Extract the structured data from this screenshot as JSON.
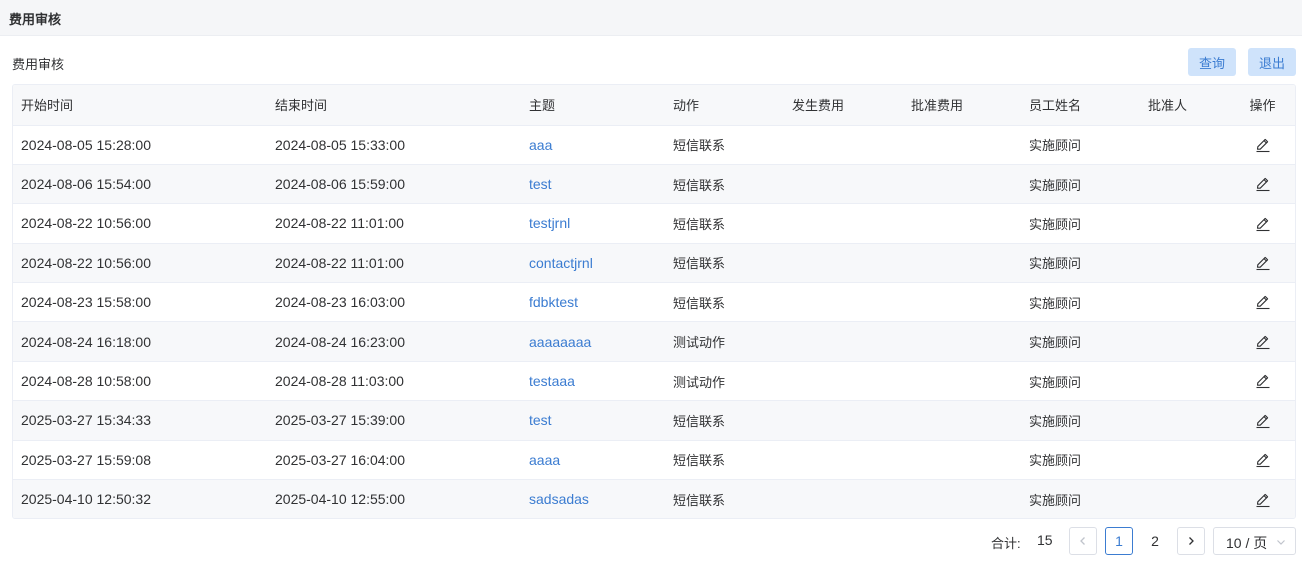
{
  "header": {
    "title": "费用审核"
  },
  "section": {
    "title": "费用审核"
  },
  "toolbar": {
    "query_label": "查询",
    "exit_label": "退出"
  },
  "table": {
    "columns": [
      "开始时间",
      "结束时间",
      "主题",
      "动作",
      "发生费用",
      "批准费用",
      "员工姓名",
      "批准人",
      "操作"
    ],
    "rows": [
      {
        "start": "2024-08-05 15:28:00",
        "end": "2024-08-05 15:33:00",
        "subject": "aaa",
        "action": "短信联系",
        "cost": "",
        "approved_cost": "",
        "employee": "实施顾问",
        "approver": ""
      },
      {
        "start": "2024-08-06 15:54:00",
        "end": "2024-08-06 15:59:00",
        "subject": "test",
        "action": "短信联系",
        "cost": "",
        "approved_cost": "",
        "employee": "实施顾问",
        "approver": ""
      },
      {
        "start": "2024-08-22 10:56:00",
        "end": "2024-08-22 11:01:00",
        "subject": "testjrnl",
        "action": "短信联系",
        "cost": "",
        "approved_cost": "",
        "employee": "实施顾问",
        "approver": ""
      },
      {
        "start": "2024-08-22 10:56:00",
        "end": "2024-08-22 11:01:00",
        "subject": "contactjrnl",
        "action": "短信联系",
        "cost": "",
        "approved_cost": "",
        "employee": "实施顾问",
        "approver": ""
      },
      {
        "start": "2024-08-23 15:58:00",
        "end": "2024-08-23 16:03:00",
        "subject": "fdbktest",
        "action": "短信联系",
        "cost": "",
        "approved_cost": "",
        "employee": "实施顾问",
        "approver": ""
      },
      {
        "start": "2024-08-24 16:18:00",
        "end": "2024-08-24 16:23:00",
        "subject": "aaaaaaaa",
        "action": "测试动作",
        "cost": "",
        "approved_cost": "",
        "employee": "实施顾问",
        "approver": ""
      },
      {
        "start": "2024-08-28 10:58:00",
        "end": "2024-08-28 11:03:00",
        "subject": "testaaa",
        "action": "测试动作",
        "cost": "",
        "approved_cost": "",
        "employee": "实施顾问",
        "approver": ""
      },
      {
        "start": "2025-03-27 15:34:33",
        "end": "2025-03-27 15:39:00",
        "subject": "test",
        "action": "短信联系",
        "cost": "",
        "approved_cost": "",
        "employee": "实施顾问",
        "approver": ""
      },
      {
        "start": "2025-03-27 15:59:08",
        "end": "2025-03-27 16:04:00",
        "subject": "aaaa",
        "action": "短信联系",
        "cost": "",
        "approved_cost": "",
        "employee": "实施顾问",
        "approver": ""
      },
      {
        "start": "2025-04-10 12:50:32",
        "end": "2025-04-10 12:55:00",
        "subject": "sadsadas",
        "action": "短信联系",
        "cost": "",
        "approved_cost": "",
        "employee": "实施顾问",
        "approver": ""
      }
    ],
    "row_action_icon": "edit-icon"
  },
  "pagination": {
    "total_label": "合计:",
    "total": "15",
    "pages": [
      "1",
      "2"
    ],
    "current_page": "1",
    "page_size": "10 / 页",
    "prev_icon": "chevron-left-icon",
    "next_icon": "chevron-right-icon"
  },
  "colors": {
    "accent": "#3b7cd1",
    "button_bg": "#cfe3fb",
    "header_bg": "#f5f6f8",
    "stripe_bg": "#f7f8fa"
  }
}
